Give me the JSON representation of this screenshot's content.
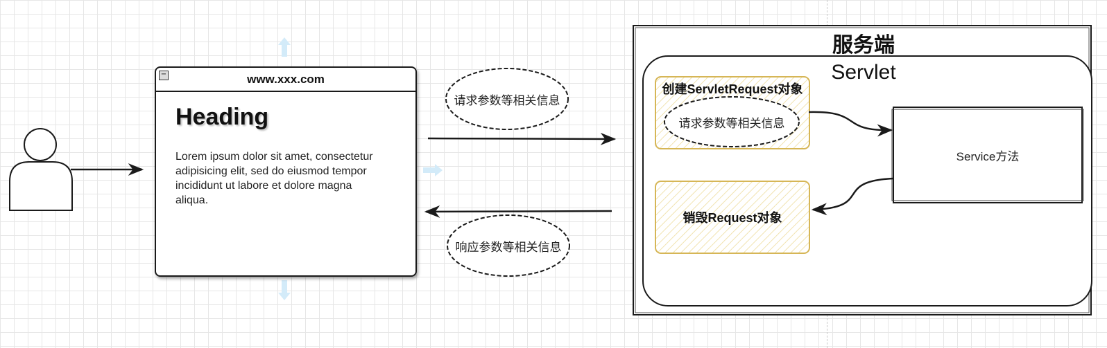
{
  "browser": {
    "url": "www.xxx.com",
    "heading": "Heading",
    "body": "Lorem ipsum dolor sit amet, consectetur adipisicing elit, sed do eiusmod tempor incididunt ut labore et dolore magna aliqua."
  },
  "request_label": "请求参数等相关信息",
  "response_label": "响应参数等相关信息",
  "server": {
    "title": "服务端",
    "servlet_title": "Servlet",
    "create_box_title": "创建ServletRequest对象",
    "inner_request_label": "请求参数等相关信息",
    "destroy_box_title": "销毁Request对象",
    "service_label": "Service方法"
  },
  "colors": {
    "stroke": "#1a1a1a",
    "highlight_border": "#d6b656",
    "highlight_fill": "#fff9e6",
    "guide_arrow": "#cfe8f7"
  }
}
